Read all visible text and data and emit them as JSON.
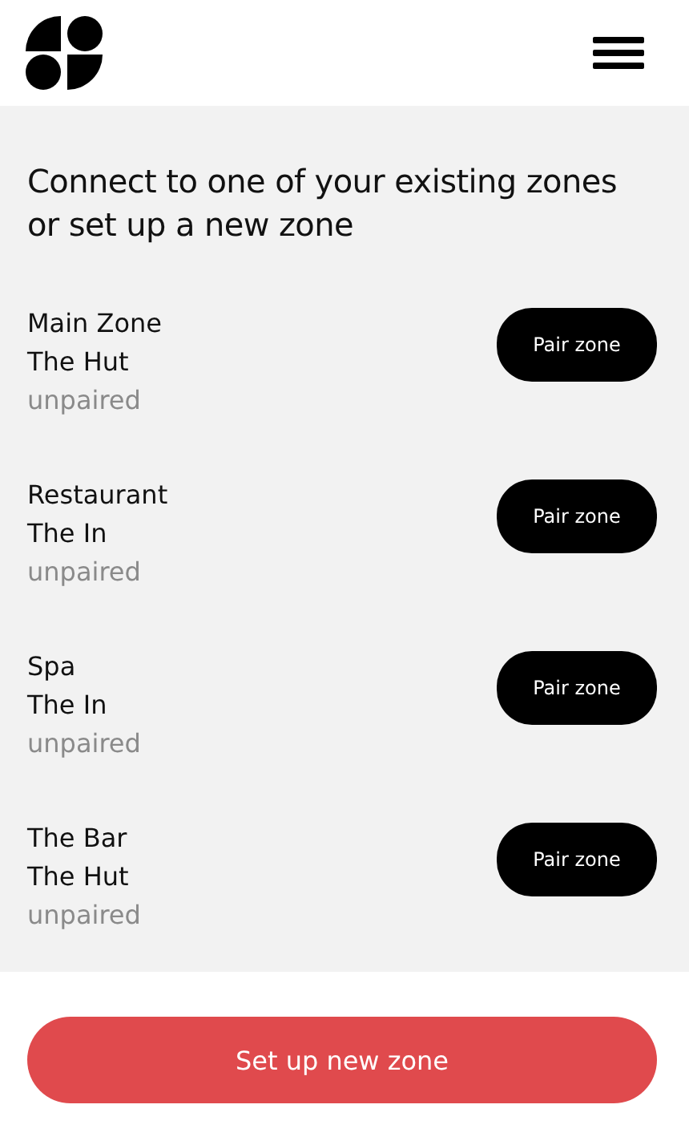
{
  "heading": "Connect to one of your existing zones or set up a new zone",
  "zones": [
    {
      "name": "Main Zone",
      "venue": "The Hut",
      "status": "unpaired",
      "action": "Pair zone"
    },
    {
      "name": "Restaurant",
      "venue": "The In",
      "status": "unpaired",
      "action": "Pair zone"
    },
    {
      "name": "Spa",
      "venue": "The In",
      "status": "unpaired",
      "action": "Pair zone"
    },
    {
      "name": "The Bar",
      "venue": "The Hut",
      "status": "unpaired",
      "action": "Pair zone"
    }
  ],
  "primary_button": "Set up new zone"
}
